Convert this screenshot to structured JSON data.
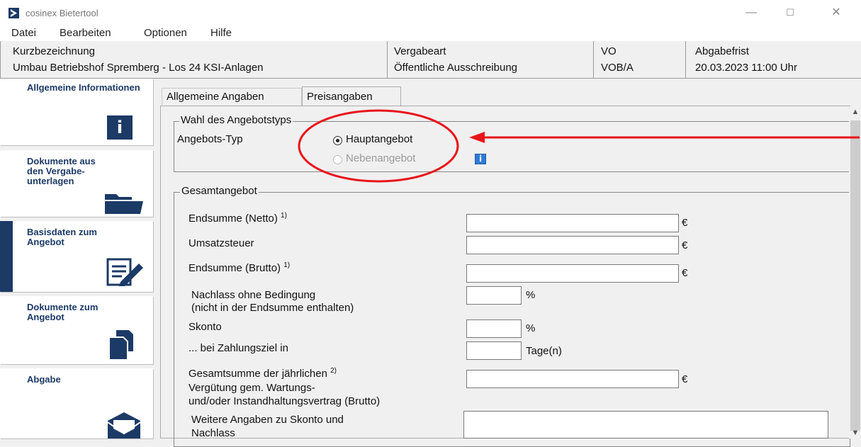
{
  "window": {
    "title": "cosinex Bietertool",
    "controls": {
      "minimize": "—",
      "maximize": "☐",
      "close": "✕"
    }
  },
  "menu": [
    "Datei",
    "Bearbeiten",
    "Optionen",
    "Hilfe"
  ],
  "header": {
    "kurz_label": "Kurzbezeichnung",
    "kurz_value": "Umbau Betriebshof Spremberg - Los 24 KSI-Anlagen",
    "vergabeart_label": "Vergabeart",
    "vergabeart_value": "Öffentliche Ausschreibung",
    "vo_label": "VO",
    "vo_value": "VOB/A",
    "frist_label": "Abgabefrist",
    "frist_value": "20.03.2023 11:00 Uhr"
  },
  "sidebar": {
    "items": [
      {
        "label": "Allgemeine Informationen",
        "icon": "info-icon"
      },
      {
        "label": "Dokumente aus den Vergabe-unterlagen",
        "icon": "folder-icon"
      },
      {
        "label": "Basisdaten zum Angebot",
        "icon": "edit-form-icon",
        "active": true
      },
      {
        "label": "Dokumente zum Angebot",
        "icon": "documents-icon"
      },
      {
        "label": "Abgabe",
        "icon": "envelope-icon"
      }
    ]
  },
  "tabs": {
    "general": "Allgemeine Angaben",
    "prices": "Preisangaben",
    "active": "prices"
  },
  "angebotstyp": {
    "legend": "Wahl des Angebotstyps",
    "label": "Angebots-Typ",
    "option_main": "Hauptangebot",
    "option_side": "Nebenangebot",
    "selected": "Hauptangebot"
  },
  "gesamt": {
    "legend": "Gesamtangebot",
    "netto_label": "Endsumme (Netto)",
    "netto_note": "1)",
    "netto_value": "",
    "ust_label": "Umsatzsteuer",
    "ust_value": "",
    "brutto_label": "Endsumme (Brutto)",
    "brutto_note": "1)",
    "brutto_value": "",
    "nachlass_label_1": "Nachlass ohne Bedingung",
    "nachlass_label_2": "(nicht in der Endsumme enthalten)",
    "nachlass_value": "",
    "skonto_label": "Skonto",
    "skonto_value": "",
    "zahlungsziel_label": "... bei Zahlungsziel in",
    "zahlungsziel_value": "",
    "gesamtsumme_label_1": "Gesamtsumme der jährlichen",
    "gesamtsumme_note": "2)",
    "gesamtsumme_label_2": "Vergütung gem. Wartungs-",
    "gesamtsumme_label_3": "und/oder Instandhaltungsvertrag (Brutto)",
    "gesamtsumme_value": "",
    "weitere_label_1": "Weitere Angaben zu Skonto und",
    "weitere_label_2": "Nachlass",
    "weitere_value": "",
    "unit_euro": "€",
    "unit_percent": "%",
    "unit_days": "Tage(n)"
  },
  "colors": {
    "annotation": "#e8141b",
    "nav_accent": "#1c3a66",
    "info_badge": "#2e7bd6"
  }
}
